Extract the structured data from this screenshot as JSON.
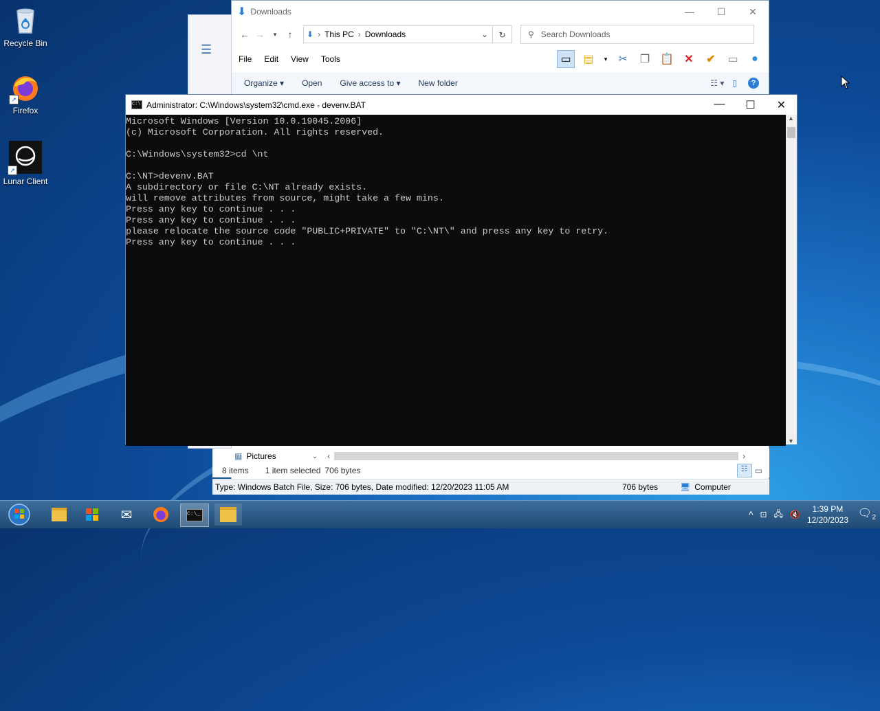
{
  "desktop": {
    "icons": [
      {
        "label": "Recycle Bin",
        "icon": "recycle-bin-icon"
      },
      {
        "label": "Firefox",
        "icon": "firefox-icon"
      },
      {
        "label": "Lunar Client",
        "icon": "lunar-client-icon"
      }
    ]
  },
  "explorer": {
    "title": "Downloads",
    "breadcrumb": [
      "This PC",
      "Downloads"
    ],
    "search_placeholder": "Search Downloads",
    "menu": [
      "File",
      "Edit",
      "View",
      "Tools"
    ],
    "commands": [
      "Organize",
      "Open",
      "Give access to",
      "New folder"
    ],
    "nav_item": "Pictures",
    "status": {
      "items": "8 items",
      "selected": "1 item selected",
      "size": "706 bytes"
    },
    "details_bar": {
      "info": "Type: Windows Batch File, Size: 706 bytes, Date modified: 12/20/2023 11:05 AM",
      "size": "706 bytes",
      "location": "Computer"
    }
  },
  "cmd": {
    "title": "Administrator: C:\\Windows\\system32\\cmd.exe - devenv.BAT",
    "lines": [
      "Microsoft Windows [Version 10.0.19045.2006]",
      "(c) Microsoft Corporation. All rights reserved.",
      "",
      "C:\\Windows\\system32>cd \\nt",
      "",
      "C:\\NT>devenv.BAT",
      "A subdirectory or file C:\\NT already exists.",
      "will remove attributes from source, might take a few mins.",
      "Press any key to continue . . .",
      "Press any key to continue . . .",
      "please relocate the source code \"PUBLIC+PRIVATE\" to \"C:\\NT\\\" and press any key to retry.",
      "Press any key to continue . . ."
    ]
  },
  "taskbar": {
    "apps": [
      "start-orb-icon",
      "file-explorer-icon",
      "store-icon",
      "mail-icon",
      "firefox-icon",
      "cmd-icon",
      "folder-icon"
    ],
    "clock_time": "1:39 PM",
    "clock_date": "12/20/2023",
    "notification_count": "2"
  },
  "colors": {
    "console_bg": "#0c0c0c",
    "console_fg": "#cccccc",
    "taskbar": "#2a5a86"
  }
}
